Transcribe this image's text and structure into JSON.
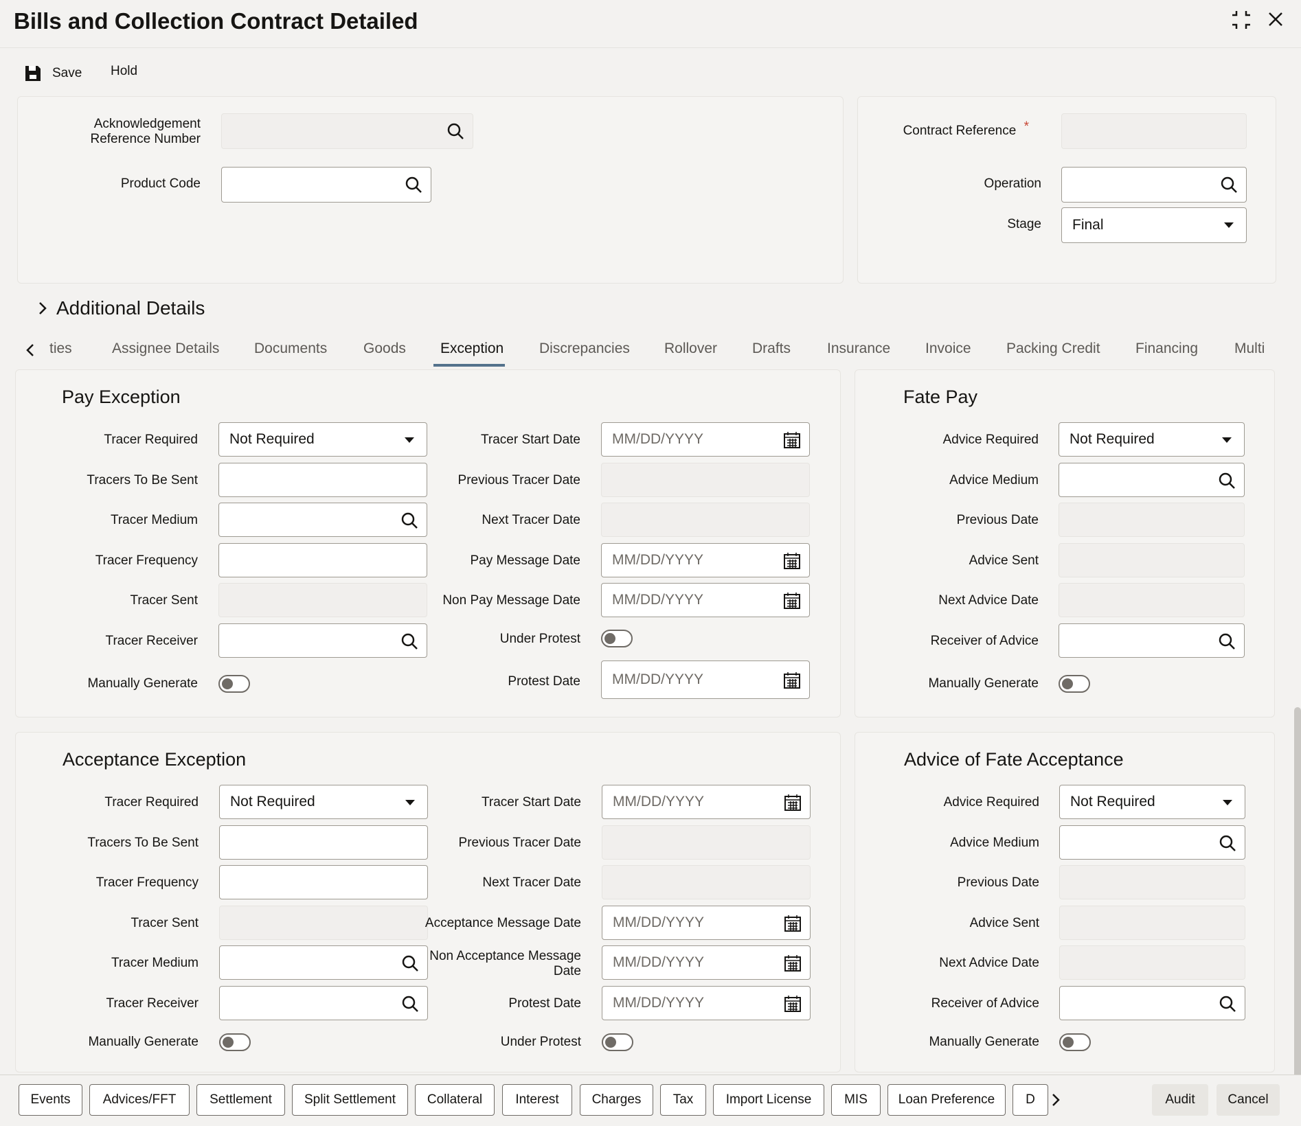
{
  "window": {
    "title": "Bills and Collection Contract Detailed"
  },
  "toolbar": {
    "save_label": "Save",
    "hold_label": "Hold"
  },
  "header": {
    "ack_ref_label": "Acknowledgement Reference Number",
    "product_code_label": "Product Code",
    "contract_ref_label": "Contract Reference",
    "required_marker": "*",
    "operation_label": "Operation",
    "stage_label": "Stage",
    "stage_value": "Final"
  },
  "additional_details": {
    "label": "Additional Details"
  },
  "tabs": [
    "ties",
    "Assignee Details",
    "Documents",
    "Goods",
    "Exception",
    "Discrepancies",
    "Rollover",
    "Drafts",
    "Insurance",
    "Invoice",
    "Packing Credit",
    "Financing",
    "Multi"
  ],
  "active_tab": "Exception",
  "pay_exception": {
    "title": "Pay Exception",
    "tracer_required_label": "Tracer Required",
    "tracer_required_value": "Not Required",
    "tracers_to_be_sent_label": "Tracers To Be Sent",
    "tracer_medium_label": "Tracer Medium",
    "tracer_frequency_label": "Tracer Frequency",
    "tracer_sent_label": "Tracer Sent",
    "tracer_receiver_label": "Tracer Receiver",
    "manually_generate_label": "Manually Generate",
    "tracer_start_date_label": "Tracer Start Date",
    "previous_tracer_date_label": "Previous Tracer Date",
    "next_tracer_date_label": "Next Tracer Date",
    "pay_message_date_label": "Pay Message Date",
    "non_pay_message_date_label": "Non Pay Message Date",
    "under_protest_label": "Under Protest",
    "protest_date_label": "Protest Date"
  },
  "fate_pay": {
    "title": "Fate Pay",
    "advice_required_label": "Advice Required",
    "advice_required_value": "Not Required",
    "advice_medium_label": "Advice Medium",
    "previous_date_label": "Previous Date",
    "advice_sent_label": "Advice Sent",
    "next_advice_date_label": "Next Advice Date",
    "receiver_of_advice_label": "Receiver of Advice",
    "manually_generate_label": "Manually Generate"
  },
  "acceptance_exception": {
    "title": "Acceptance Exception",
    "tracer_required_label": "Tracer Required",
    "tracer_required_value": "Not Required",
    "tracers_to_be_sent_label": "Tracers To Be Sent",
    "tracer_frequency_label": "Tracer Frequency",
    "tracer_sent_label": "Tracer Sent",
    "tracer_medium_label": "Tracer Medium",
    "tracer_receiver_label": "Tracer Receiver",
    "manually_generate_label": "Manually Generate",
    "tracer_start_date_label": "Tracer Start Date",
    "previous_tracer_date_label": "Previous Tracer Date",
    "next_tracer_date_label": "Next Tracer Date",
    "acceptance_message_date_label": "Acceptance Message Date",
    "non_acceptance_message_date_label": "Non Acceptance Message Date",
    "protest_date_label": "Protest Date",
    "under_protest_label": "Under Protest"
  },
  "advice_fate_acceptance": {
    "title": "Advice of Fate Acceptance",
    "advice_required_label": "Advice Required",
    "advice_required_value": "Not Required",
    "advice_medium_label": "Advice Medium",
    "previous_date_label": "Previous Date",
    "advice_sent_label": "Advice Sent",
    "next_advice_date_label": "Next Advice Date",
    "receiver_of_advice_label": "Receiver of Advice",
    "manually_generate_label": "Manually Generate"
  },
  "date_placeholder": "MM/DD/YYYY",
  "bottom_buttons": [
    "Events",
    "Advices/FFT",
    "Settlement",
    "Split Settlement",
    "Collateral",
    "Interest",
    "Charges",
    "Tax",
    "Import License",
    "MIS",
    "Loan Preference",
    "D"
  ],
  "audit_label": "Audit",
  "cancel_label": "Cancel",
  "colors": {
    "accent": "#54728c",
    "required": "#c74634",
    "background": "#f3f2f0"
  }
}
